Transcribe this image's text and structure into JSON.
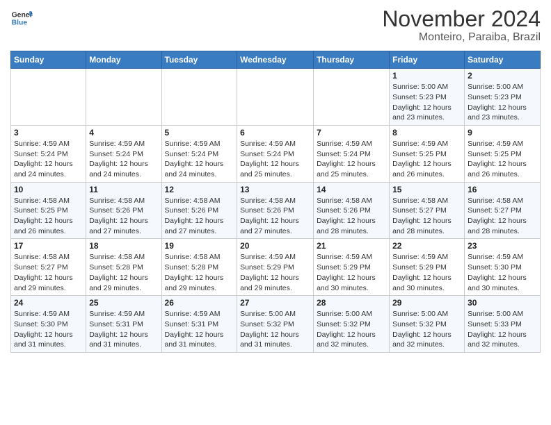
{
  "logo": {
    "line1": "General",
    "line2": "Blue"
  },
  "title": "November 2024",
  "subtitle": "Monteiro, Paraiba, Brazil",
  "weekdays": [
    "Sunday",
    "Monday",
    "Tuesday",
    "Wednesday",
    "Thursday",
    "Friday",
    "Saturday"
  ],
  "weeks": [
    [
      {
        "day": "",
        "detail": ""
      },
      {
        "day": "",
        "detail": ""
      },
      {
        "day": "",
        "detail": ""
      },
      {
        "day": "",
        "detail": ""
      },
      {
        "day": "",
        "detail": ""
      },
      {
        "day": "1",
        "detail": "Sunrise: 5:00 AM\nSunset: 5:23 PM\nDaylight: 12 hours\nand 23 minutes."
      },
      {
        "day": "2",
        "detail": "Sunrise: 5:00 AM\nSunset: 5:23 PM\nDaylight: 12 hours\nand 23 minutes."
      }
    ],
    [
      {
        "day": "3",
        "detail": "Sunrise: 4:59 AM\nSunset: 5:24 PM\nDaylight: 12 hours\nand 24 minutes."
      },
      {
        "day": "4",
        "detail": "Sunrise: 4:59 AM\nSunset: 5:24 PM\nDaylight: 12 hours\nand 24 minutes."
      },
      {
        "day": "5",
        "detail": "Sunrise: 4:59 AM\nSunset: 5:24 PM\nDaylight: 12 hours\nand 24 minutes."
      },
      {
        "day": "6",
        "detail": "Sunrise: 4:59 AM\nSunset: 5:24 PM\nDaylight: 12 hours\nand 25 minutes."
      },
      {
        "day": "7",
        "detail": "Sunrise: 4:59 AM\nSunset: 5:24 PM\nDaylight: 12 hours\nand 25 minutes."
      },
      {
        "day": "8",
        "detail": "Sunrise: 4:59 AM\nSunset: 5:25 PM\nDaylight: 12 hours\nand 26 minutes."
      },
      {
        "day": "9",
        "detail": "Sunrise: 4:59 AM\nSunset: 5:25 PM\nDaylight: 12 hours\nand 26 minutes."
      }
    ],
    [
      {
        "day": "10",
        "detail": "Sunrise: 4:58 AM\nSunset: 5:25 PM\nDaylight: 12 hours\nand 26 minutes."
      },
      {
        "day": "11",
        "detail": "Sunrise: 4:58 AM\nSunset: 5:26 PM\nDaylight: 12 hours\nand 27 minutes."
      },
      {
        "day": "12",
        "detail": "Sunrise: 4:58 AM\nSunset: 5:26 PM\nDaylight: 12 hours\nand 27 minutes."
      },
      {
        "day": "13",
        "detail": "Sunrise: 4:58 AM\nSunset: 5:26 PM\nDaylight: 12 hours\nand 27 minutes."
      },
      {
        "day": "14",
        "detail": "Sunrise: 4:58 AM\nSunset: 5:26 PM\nDaylight: 12 hours\nand 28 minutes."
      },
      {
        "day": "15",
        "detail": "Sunrise: 4:58 AM\nSunset: 5:27 PM\nDaylight: 12 hours\nand 28 minutes."
      },
      {
        "day": "16",
        "detail": "Sunrise: 4:58 AM\nSunset: 5:27 PM\nDaylight: 12 hours\nand 28 minutes."
      }
    ],
    [
      {
        "day": "17",
        "detail": "Sunrise: 4:58 AM\nSunset: 5:27 PM\nDaylight: 12 hours\nand 29 minutes."
      },
      {
        "day": "18",
        "detail": "Sunrise: 4:58 AM\nSunset: 5:28 PM\nDaylight: 12 hours\nand 29 minutes."
      },
      {
        "day": "19",
        "detail": "Sunrise: 4:58 AM\nSunset: 5:28 PM\nDaylight: 12 hours\nand 29 minutes."
      },
      {
        "day": "20",
        "detail": "Sunrise: 4:59 AM\nSunset: 5:29 PM\nDaylight: 12 hours\nand 29 minutes."
      },
      {
        "day": "21",
        "detail": "Sunrise: 4:59 AM\nSunset: 5:29 PM\nDaylight: 12 hours\nand 30 minutes."
      },
      {
        "day": "22",
        "detail": "Sunrise: 4:59 AM\nSunset: 5:29 PM\nDaylight: 12 hours\nand 30 minutes."
      },
      {
        "day": "23",
        "detail": "Sunrise: 4:59 AM\nSunset: 5:30 PM\nDaylight: 12 hours\nand 30 minutes."
      }
    ],
    [
      {
        "day": "24",
        "detail": "Sunrise: 4:59 AM\nSunset: 5:30 PM\nDaylight: 12 hours\nand 31 minutes."
      },
      {
        "day": "25",
        "detail": "Sunrise: 4:59 AM\nSunset: 5:31 PM\nDaylight: 12 hours\nand 31 minutes."
      },
      {
        "day": "26",
        "detail": "Sunrise: 4:59 AM\nSunset: 5:31 PM\nDaylight: 12 hours\nand 31 minutes."
      },
      {
        "day": "27",
        "detail": "Sunrise: 5:00 AM\nSunset: 5:32 PM\nDaylight: 12 hours\nand 31 minutes."
      },
      {
        "day": "28",
        "detail": "Sunrise: 5:00 AM\nSunset: 5:32 PM\nDaylight: 12 hours\nand 32 minutes."
      },
      {
        "day": "29",
        "detail": "Sunrise: 5:00 AM\nSunset: 5:32 PM\nDaylight: 12 hours\nand 32 minutes."
      },
      {
        "day": "30",
        "detail": "Sunrise: 5:00 AM\nSunset: 5:33 PM\nDaylight: 12 hours\nand 32 minutes."
      }
    ]
  ]
}
